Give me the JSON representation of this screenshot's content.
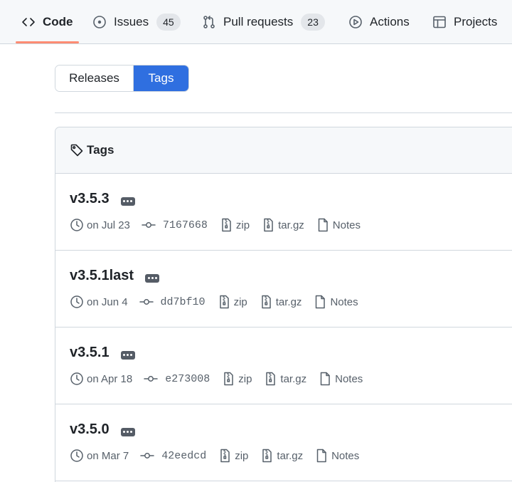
{
  "nav": {
    "code": "Code",
    "issues": "Issues",
    "issues_count": "45",
    "pull_requests": "Pull requests",
    "pull_requests_count": "23",
    "actions": "Actions",
    "projects": "Projects"
  },
  "toggle": {
    "releases": "Releases",
    "tags": "Tags"
  },
  "box": {
    "title": "Tags"
  },
  "tags": [
    {
      "name": "v3.5.3",
      "date": "on Jul 23",
      "sha": "7167668",
      "zip": "zip",
      "targz": "tar.gz",
      "notes": "Notes"
    },
    {
      "name": "v3.5.1last",
      "date": "on Jun 4",
      "sha": "dd7bf10",
      "zip": "zip",
      "targz": "tar.gz",
      "notes": "Notes"
    },
    {
      "name": "v3.5.1",
      "date": "on Apr 18",
      "sha": "e273008",
      "zip": "zip",
      "targz": "tar.gz",
      "notes": "Notes"
    },
    {
      "name": "v3.5.0",
      "date": "on Mar 7",
      "sha": "42eedcd",
      "zip": "zip",
      "targz": "tar.gz",
      "notes": "Notes"
    }
  ],
  "colors": {
    "accent": "#2f6fe0",
    "underline": "#fd8c73",
    "border": "#d0d7de"
  }
}
